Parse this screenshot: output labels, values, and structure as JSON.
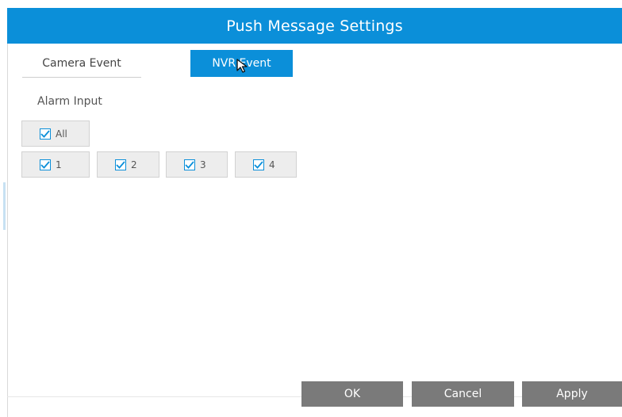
{
  "dialog": {
    "title": "Push Message Settings"
  },
  "tabs": {
    "camera_event": "Camera Event",
    "nvr_event": "NVR Event",
    "active": "nvr_event"
  },
  "alarm_input": {
    "label": "Alarm Input",
    "all": {
      "label": "All",
      "checked": true
    },
    "inputs": [
      {
        "label": "1",
        "checked": true
      },
      {
        "label": "2",
        "checked": true
      },
      {
        "label": "3",
        "checked": true
      },
      {
        "label": "4",
        "checked": true
      }
    ]
  },
  "footer": {
    "ok": "OK",
    "cancel": "Cancel",
    "apply": "Apply"
  },
  "colors": {
    "accent": "#0b8fd9",
    "button_gray": "#7a7a7a",
    "checkbox_bg": "#ededed"
  },
  "icons": {
    "checkbox": "checkmark-icon",
    "pointer": "mouse-cursor-icon"
  }
}
